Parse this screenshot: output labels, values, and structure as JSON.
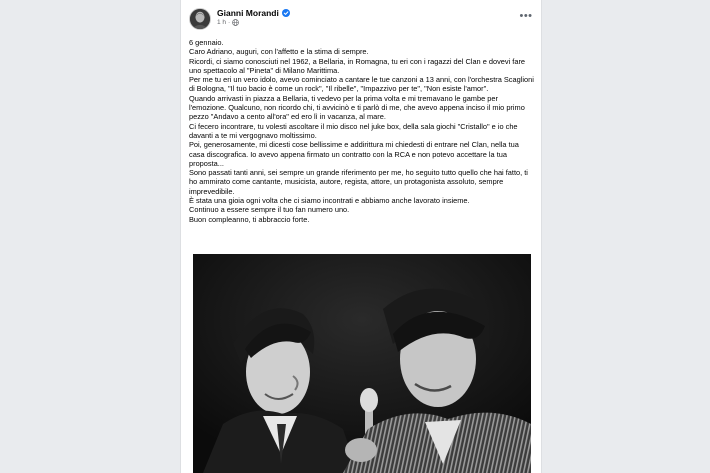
{
  "post": {
    "author": "Gianni Morandi",
    "time": "1 h",
    "separator": "·",
    "more_icon": "ellipsis-horizontal",
    "verified_color": "#1877f2",
    "paragraphs": [
      "6 gennaio.",
      "Caro Adriano, auguri, con l'affetto e la stima di sempre.",
      "Ricordi, ci siamo conosciuti nel 1962, a Bellaria, in Romagna, tu eri con i ragazzi del Clan e dovevi fare uno spettacolo al \"Pineta\" di Milano Marittima.",
      "Per me tu eri un vero idolo, avevo cominciato a cantare le tue canzoni a 13 anni, con l'orchestra Scaglioni di Bologna, \"Il tuo bacio è come un rock\", \"Il ribelle\", \"Impazzivo per te\", \"Non esiste l'amor\".",
      "Quando arrivasti in piazza a Bellaria, ti vedevo per la prima volta e mi tremavano le gambe per l'emozione. Qualcuno, non ricordo chi, ti avvicinò e ti parlò di me, che avevo appena inciso il mio primo pezzo \"Andavo a cento all'ora\" ed ero lì in vacanza, al mare.",
      "Ci fecero incontrare, tu volesti ascoltare il mio disco nel juke box, della sala giochi \"Cristallo\" e io che davanti a te mi vergognavo moltissimo.",
      "Poi, generosamente, mi dicesti cose bellissime e addirittura mi chiedesti di entrare nel Clan, nella tua casa discografica. Io avevo appena firmato un contratto con la RCA e non potevo accettare la tua proposta...",
      "Sono passati tanti anni, sei sempre un grande riferimento per me, ho seguito tutto quello che hai fatto, ti ho ammirato come cantante, musicista, autore, regista, attore, un protagonista assoluto, sempre imprevedibile.",
      "È stata una gioia ogni volta che ci siamo incontrati e abbiamo anche lavorato insieme.",
      "Continuo a essere sempre il tuo fan numero uno.",
      "Buon compleanno, ti abbraccio forte."
    ]
  }
}
